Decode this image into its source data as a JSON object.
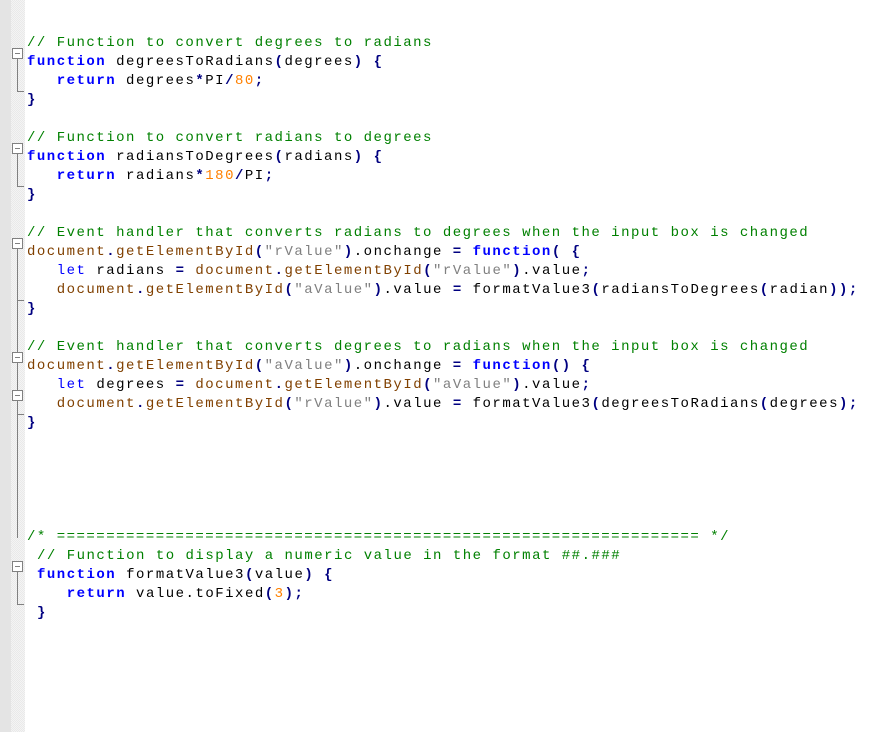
{
  "editor": {
    "language": "javascript",
    "colors": {
      "comment": "#008000",
      "keyword": "#0000ff",
      "string": "#808080",
      "number": "#ff8000",
      "operator": "#000080",
      "object": "#804000",
      "text": "#000000"
    },
    "lines": [
      {
        "indent": 0,
        "tokens": []
      },
      {
        "indent": 0,
        "tokens": [
          {
            "t": "cmt",
            "v": "// Function to convert degrees to radians"
          }
        ]
      },
      {
        "indent": 0,
        "tokens": [
          {
            "t": "kw",
            "v": "function"
          },
          {
            "t": "ident",
            "v": " degreesToRadians"
          },
          {
            "t": "punc",
            "v": "("
          },
          {
            "t": "ident",
            "v": "degrees"
          },
          {
            "t": "punc",
            "v": ")"
          },
          {
            "t": "ident",
            "v": " "
          },
          {
            "t": "punc",
            "v": "{"
          }
        ]
      },
      {
        "indent": 0,
        "tokens": [
          {
            "t": "ident",
            "v": "   "
          },
          {
            "t": "kw",
            "v": "return"
          },
          {
            "t": "ident",
            "v": " degrees"
          },
          {
            "t": "op",
            "v": "*"
          },
          {
            "t": "ident",
            "v": "PI"
          },
          {
            "t": "op",
            "v": "/"
          },
          {
            "t": "num",
            "v": "80"
          },
          {
            "t": "punc",
            "v": ";"
          }
        ]
      },
      {
        "indent": 0,
        "tokens": [
          {
            "t": "punc",
            "v": "}"
          }
        ]
      },
      {
        "indent": 0,
        "tokens": []
      },
      {
        "indent": 0,
        "tokens": [
          {
            "t": "cmt",
            "v": "// Function to convert radians to degrees"
          }
        ]
      },
      {
        "indent": 0,
        "tokens": [
          {
            "t": "kw",
            "v": "function"
          },
          {
            "t": "ident",
            "v": " radiansToDegrees"
          },
          {
            "t": "punc",
            "v": "("
          },
          {
            "t": "ident",
            "v": "radians"
          },
          {
            "t": "punc",
            "v": ")"
          },
          {
            "t": "ident",
            "v": " "
          },
          {
            "t": "punc",
            "v": "{"
          }
        ]
      },
      {
        "indent": 0,
        "tokens": [
          {
            "t": "ident",
            "v": "   "
          },
          {
            "t": "kw",
            "v": "return"
          },
          {
            "t": "ident",
            "v": " radians"
          },
          {
            "t": "op",
            "v": "*"
          },
          {
            "t": "num",
            "v": "180"
          },
          {
            "t": "op",
            "v": "/"
          },
          {
            "t": "ident",
            "v": "PI"
          },
          {
            "t": "punc",
            "v": ";"
          }
        ]
      },
      {
        "indent": 0,
        "tokens": [
          {
            "t": "punc",
            "v": "}"
          }
        ]
      },
      {
        "indent": 0,
        "tokens": []
      },
      {
        "indent": 0,
        "tokens": [
          {
            "t": "cmt",
            "v": "// Event handler that converts radians to degrees when the input box is changed"
          }
        ]
      },
      {
        "indent": 0,
        "tokens": [
          {
            "t": "obj",
            "v": "document"
          },
          {
            "t": "punc",
            "v": "."
          },
          {
            "t": "obj",
            "v": "getElementById"
          },
          {
            "t": "punc",
            "v": "("
          },
          {
            "t": "str",
            "v": "\"rValue\""
          },
          {
            "t": "punc",
            "v": ")"
          },
          {
            "t": "ident",
            "v": ".onchange "
          },
          {
            "t": "op",
            "v": "="
          },
          {
            "t": "ident",
            "v": " "
          },
          {
            "t": "kw",
            "v": "function"
          },
          {
            "t": "punc",
            "v": "("
          },
          {
            "t": "ident",
            "v": " "
          },
          {
            "t": "punc",
            "v": "{"
          }
        ]
      },
      {
        "indent": 0,
        "tokens": [
          {
            "t": "ident",
            "v": "   "
          },
          {
            "t": "kw2",
            "v": "let"
          },
          {
            "t": "ident",
            "v": " radians "
          },
          {
            "t": "op",
            "v": "="
          },
          {
            "t": "ident",
            "v": " "
          },
          {
            "t": "obj",
            "v": "document"
          },
          {
            "t": "punc",
            "v": "."
          },
          {
            "t": "obj",
            "v": "getElementById"
          },
          {
            "t": "punc",
            "v": "("
          },
          {
            "t": "str",
            "v": "\"rValue\""
          },
          {
            "t": "punc",
            "v": ")"
          },
          {
            "t": "ident",
            "v": ".value"
          },
          {
            "t": "punc",
            "v": ";"
          }
        ]
      },
      {
        "indent": 0,
        "tokens": [
          {
            "t": "ident",
            "v": "   "
          },
          {
            "t": "obj",
            "v": "document"
          },
          {
            "t": "punc",
            "v": "."
          },
          {
            "t": "obj",
            "v": "getElementById"
          },
          {
            "t": "punc",
            "v": "("
          },
          {
            "t": "str",
            "v": "\"aValue\""
          },
          {
            "t": "punc",
            "v": ")"
          },
          {
            "t": "ident",
            "v": ".value "
          },
          {
            "t": "op",
            "v": "="
          },
          {
            "t": "ident",
            "v": " formatValue3"
          },
          {
            "t": "punc",
            "v": "("
          },
          {
            "t": "ident",
            "v": "radiansToDegrees"
          },
          {
            "t": "punc",
            "v": "("
          },
          {
            "t": "ident",
            "v": "radian"
          },
          {
            "t": "punc",
            "v": "));"
          }
        ]
      },
      {
        "indent": 0,
        "tokens": [
          {
            "t": "punc",
            "v": "}"
          }
        ]
      },
      {
        "indent": 0,
        "tokens": []
      },
      {
        "indent": 0,
        "tokens": [
          {
            "t": "cmt",
            "v": "// Event handler that converts degrees to radians when the input box is changed"
          }
        ]
      },
      {
        "indent": 0,
        "tokens": [
          {
            "t": "obj",
            "v": "document"
          },
          {
            "t": "punc",
            "v": "."
          },
          {
            "t": "obj",
            "v": "getElementById"
          },
          {
            "t": "punc",
            "v": "("
          },
          {
            "t": "str",
            "v": "\"aValue\""
          },
          {
            "t": "punc",
            "v": ")"
          },
          {
            "t": "ident",
            "v": ".onchange "
          },
          {
            "t": "op",
            "v": "="
          },
          {
            "t": "ident",
            "v": " "
          },
          {
            "t": "kw",
            "v": "function"
          },
          {
            "t": "punc",
            "v": "()"
          },
          {
            "t": "ident",
            "v": " "
          },
          {
            "t": "punc",
            "v": "{"
          }
        ]
      },
      {
        "indent": 0,
        "tokens": [
          {
            "t": "ident",
            "v": "   "
          },
          {
            "t": "kw2",
            "v": "let"
          },
          {
            "t": "ident",
            "v": " degrees "
          },
          {
            "t": "op",
            "v": "="
          },
          {
            "t": "ident",
            "v": " "
          },
          {
            "t": "obj",
            "v": "document"
          },
          {
            "t": "punc",
            "v": "."
          },
          {
            "t": "obj",
            "v": "getElementById"
          },
          {
            "t": "punc",
            "v": "("
          },
          {
            "t": "str",
            "v": "\"aValue\""
          },
          {
            "t": "punc",
            "v": ")"
          },
          {
            "t": "ident",
            "v": ".value"
          },
          {
            "t": "punc",
            "v": ";"
          }
        ]
      },
      {
        "indent": 0,
        "tokens": [
          {
            "t": "ident",
            "v": "   "
          },
          {
            "t": "obj",
            "v": "document"
          },
          {
            "t": "punc",
            "v": "."
          },
          {
            "t": "obj",
            "v": "getElementById"
          },
          {
            "t": "punc",
            "v": "("
          },
          {
            "t": "str",
            "v": "\"rValue\""
          },
          {
            "t": "punc",
            "v": ")"
          },
          {
            "t": "ident",
            "v": ".value "
          },
          {
            "t": "op",
            "v": "="
          },
          {
            "t": "ident",
            "v": " formatValue3"
          },
          {
            "t": "punc",
            "v": "("
          },
          {
            "t": "ident",
            "v": "degreesToRadians"
          },
          {
            "t": "punc",
            "v": "("
          },
          {
            "t": "ident",
            "v": "degrees"
          },
          {
            "t": "punc",
            "v": ");"
          }
        ]
      },
      {
        "indent": 0,
        "tokens": [
          {
            "t": "punc",
            "v": "}"
          }
        ]
      },
      {
        "indent": 0,
        "tokens": []
      },
      {
        "indent": 0,
        "tokens": []
      },
      {
        "indent": 0,
        "tokens": []
      },
      {
        "indent": 0,
        "tokens": []
      },
      {
        "indent": 0,
        "tokens": []
      },
      {
        "indent": 0,
        "tokens": [
          {
            "t": "cmt",
            "v": "/* ================================================================= */"
          }
        ]
      },
      {
        "indent": 1,
        "tokens": [
          {
            "t": "cmt",
            "v": "// Function to display a numeric value in the format ##.###"
          }
        ]
      },
      {
        "indent": 1,
        "tokens": [
          {
            "t": "kw",
            "v": "function"
          },
          {
            "t": "ident",
            "v": " formatValue3"
          },
          {
            "t": "punc",
            "v": "("
          },
          {
            "t": "ident",
            "v": "value"
          },
          {
            "t": "punc",
            "v": ")"
          },
          {
            "t": "ident",
            "v": " "
          },
          {
            "t": "punc",
            "v": "{"
          }
        ]
      },
      {
        "indent": 1,
        "tokens": [
          {
            "t": "ident",
            "v": "   "
          },
          {
            "t": "kw",
            "v": "return"
          },
          {
            "t": "ident",
            "v": " value.toFixed"
          },
          {
            "t": "punc",
            "v": "("
          },
          {
            "t": "num",
            "v": "3"
          },
          {
            "t": "punc",
            "v": ");"
          }
        ]
      },
      {
        "indent": 1,
        "tokens": [
          {
            "t": "punc",
            "v": "}"
          }
        ]
      }
    ]
  }
}
